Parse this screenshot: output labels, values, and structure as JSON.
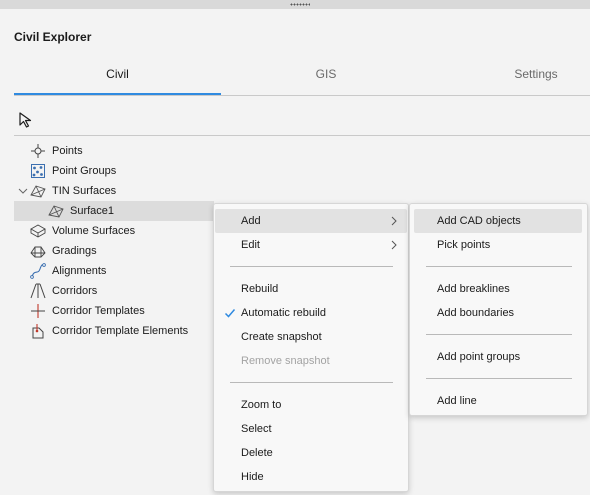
{
  "panel": {
    "title": "Civil Explorer"
  },
  "tabs": [
    {
      "label": "Civil",
      "active": true
    },
    {
      "label": "GIS",
      "active": false
    },
    {
      "label": "Settings",
      "active": false
    }
  ],
  "toolbar": {
    "select_tool_icon": "cursor-icon"
  },
  "tree": {
    "items": [
      {
        "label": "Points",
        "icon": "points-icon"
      },
      {
        "label": "Point Groups",
        "icon": "point-groups-icon"
      },
      {
        "label": "TIN Surfaces",
        "icon": "tin-surfaces-icon",
        "expanded": true
      },
      {
        "label": "Surface1",
        "icon": "surface-icon",
        "selected": true
      },
      {
        "label": "Volume Surfaces",
        "icon": "volume-surfaces-icon"
      },
      {
        "label": "Gradings",
        "icon": "gradings-icon"
      },
      {
        "label": "Alignments",
        "icon": "alignments-icon"
      },
      {
        "label": "Corridors",
        "icon": "corridors-icon"
      },
      {
        "label": "Corridor Templates",
        "icon": "corridor-templates-icon"
      },
      {
        "label": "Corridor Template Elements",
        "icon": "corridor-template-elements-icon"
      }
    ]
  },
  "context_menu": {
    "items": [
      {
        "label": "Add",
        "submenu": true,
        "hover": true
      },
      {
        "label": "Edit",
        "submenu": true
      },
      {
        "label": "Rebuild"
      },
      {
        "label": "Automatic rebuild",
        "checked": true
      },
      {
        "label": "Create snapshot"
      },
      {
        "label": "Remove snapshot",
        "disabled": true
      },
      {
        "label": "Zoom to"
      },
      {
        "label": "Select"
      },
      {
        "label": "Delete"
      },
      {
        "label": "Hide"
      }
    ]
  },
  "add_submenu": {
    "items": [
      {
        "label": "Add CAD objects",
        "hover": true
      },
      {
        "label": "Pick points"
      },
      {
        "label": "Add breaklines"
      },
      {
        "label": "Add boundaries"
      },
      {
        "label": "Add point groups"
      },
      {
        "label": "Add line"
      }
    ]
  },
  "colors": {
    "accent": "#2f8ae0",
    "selection": "#dcdcdc",
    "background": "#f3f3f3"
  }
}
